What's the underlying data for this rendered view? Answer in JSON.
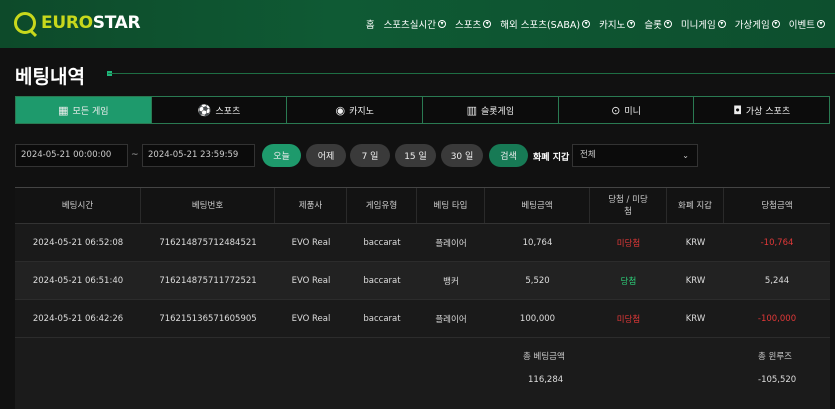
{
  "brand": {
    "part1": "EURO",
    "part2": "STAR"
  },
  "nav": [
    "홈",
    "스포츠실시간",
    "스포츠",
    "해외 스포츠(SABA)",
    "카지노",
    "슬롯",
    "미니게임",
    "가상게임",
    "이벤트"
  ],
  "page_title": "베팅내역",
  "tabs": [
    {
      "label": "모든 게임",
      "icon": "grid-icon"
    },
    {
      "label": "스포츠",
      "icon": "soccer-ball-icon"
    },
    {
      "label": "카지노",
      "icon": "casino-chip-icon"
    },
    {
      "label": "슬롯게임",
      "icon": "slot-machine-icon"
    },
    {
      "label": "미니",
      "icon": "gamepad-icon"
    },
    {
      "label": "가상 스포츠",
      "icon": "vr-headset-icon"
    }
  ],
  "filters": {
    "start_date": "2024-05-21 00:00:00",
    "separator": "~",
    "end_date": "2024-05-21 23:59:59",
    "today": "오늘",
    "yesterday": "어제",
    "d7": "7 일",
    "d15": "15 일",
    "d30": "30 일",
    "search": "검색",
    "currency_label": "화폐 지갑",
    "currency_value": "전체"
  },
  "table": {
    "headers": [
      "베팅시간",
      "베팅번호",
      "제품사",
      "게임유형",
      "베팅 타입",
      "베팅금액",
      "당첨 / 미당첨",
      "화폐 지갑",
      "당첨금액"
    ],
    "rows": [
      [
        "2024-05-21 06:52:08",
        "716214875712484521",
        "EVO Real",
        "baccarat",
        "플레이어",
        "10,764",
        "미당첨",
        "KRW",
        "-10,764"
      ],
      [
        "2024-05-21 06:51:40",
        "716214875711772521",
        "EVO Real",
        "baccarat",
        "뱅커",
        "5,520",
        "당첨",
        "KRW",
        "5,244"
      ],
      [
        "2024-05-21 06:42:26",
        "716215136571605905",
        "EVO Real",
        "baccarat",
        "플레이어",
        "100,000",
        "미당첨",
        "KRW",
        "-100,000"
      ]
    ],
    "summary": {
      "total_bet_label": "총 베팅금액",
      "total_bet_value": "116,284",
      "total_profit_label": "총 윈루즈",
      "total_profit_value": "-105,520"
    }
  },
  "colors": {
    "accent": "#1e9a6c",
    "loss": "#e03838",
    "win": "#2dd07a",
    "brand": "#c8d81c"
  }
}
